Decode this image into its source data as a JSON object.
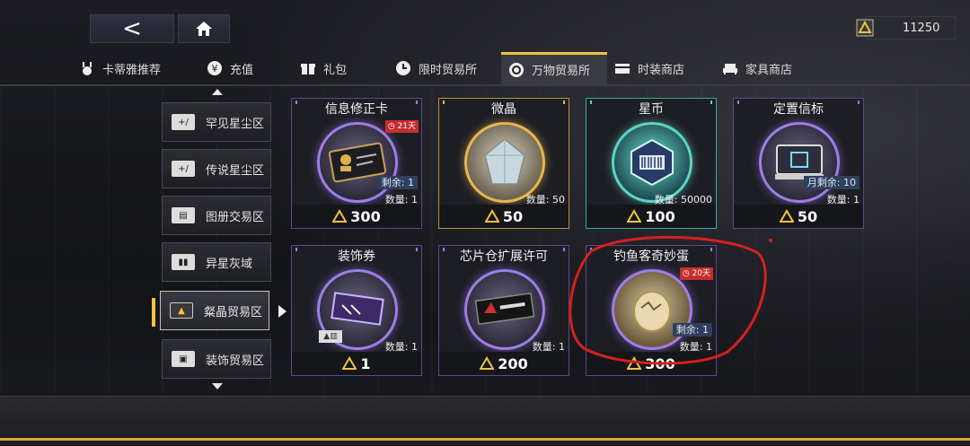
{
  "header": {
    "back_glyph": "<",
    "home_icon": "home-icon",
    "currency": {
      "icon": "crystal-icon",
      "value": "11250"
    }
  },
  "tabs": [
    {
      "label": "卡蒂雅推荐",
      "icon": "rabbit-icon",
      "active": false
    },
    {
      "label": "充值",
      "icon": "yen-icon",
      "active": false
    },
    {
      "label": "礼包",
      "icon": "gift-icon",
      "active": false
    },
    {
      "label": "限时贸易所",
      "icon": "clock-trade-icon",
      "active": false
    },
    {
      "label": "万物贸易所",
      "icon": "cycle-trade-icon",
      "active": true
    },
    {
      "label": "时装商店",
      "icon": "card-icon",
      "active": false
    },
    {
      "label": "家具商店",
      "icon": "sofa-icon",
      "active": false
    }
  ],
  "categories": [
    {
      "label": "罕见星尘区",
      "icon": "stardust-icon",
      "active": false
    },
    {
      "label": "传说星尘区",
      "icon": "stardust-icon",
      "active": false
    },
    {
      "label": "图册交易区",
      "icon": "album-icon",
      "active": false
    },
    {
      "label": "异星灰域",
      "icon": "grey-zone-icon",
      "active": false
    },
    {
      "label": "粲晶贸易区",
      "icon": "crystal-icon",
      "active": true
    },
    {
      "label": "装饰贸易区",
      "icon": "decor-icon",
      "active": false
    }
  ],
  "items": [
    {
      "title": "信息修正卡",
      "tag": "21天",
      "remain": "剩余: 1",
      "qty": "数量: 1",
      "price": "300",
      "rarity": "purple"
    },
    {
      "title": "微晶",
      "tag": "",
      "remain": "",
      "qty": "数量: 50",
      "price": "50",
      "rarity": "gold"
    },
    {
      "title": "星币",
      "tag": "",
      "remain": "",
      "qty": "数量: 50000",
      "price": "100",
      "rarity": "teal"
    },
    {
      "title": "定置信标",
      "tag": "",
      "remain": "月剩余: 10",
      "qty": "数量: 1",
      "price": "50",
      "rarity": "purple"
    },
    {
      "title": "装饰券",
      "tag": "",
      "remain": "",
      "qty": "数量: 1",
      "price": "1",
      "rarity": "purple"
    },
    {
      "title": "芯片仓扩展许可",
      "tag": "",
      "remain": "",
      "qty": "数量: 1",
      "price": "200",
      "rarity": "purple"
    },
    {
      "title": "钓鱼客奇妙蛋",
      "tag": "20天",
      "remain": "剩余: 1",
      "qty": "数量: 1",
      "price": "300",
      "rarity": "purple"
    }
  ],
  "colors": {
    "accent": "#f2c142",
    "purple": "#9d7ee6",
    "gold": "#e7b64e",
    "teal": "#5ed4c2",
    "annotation": "#d42020"
  }
}
